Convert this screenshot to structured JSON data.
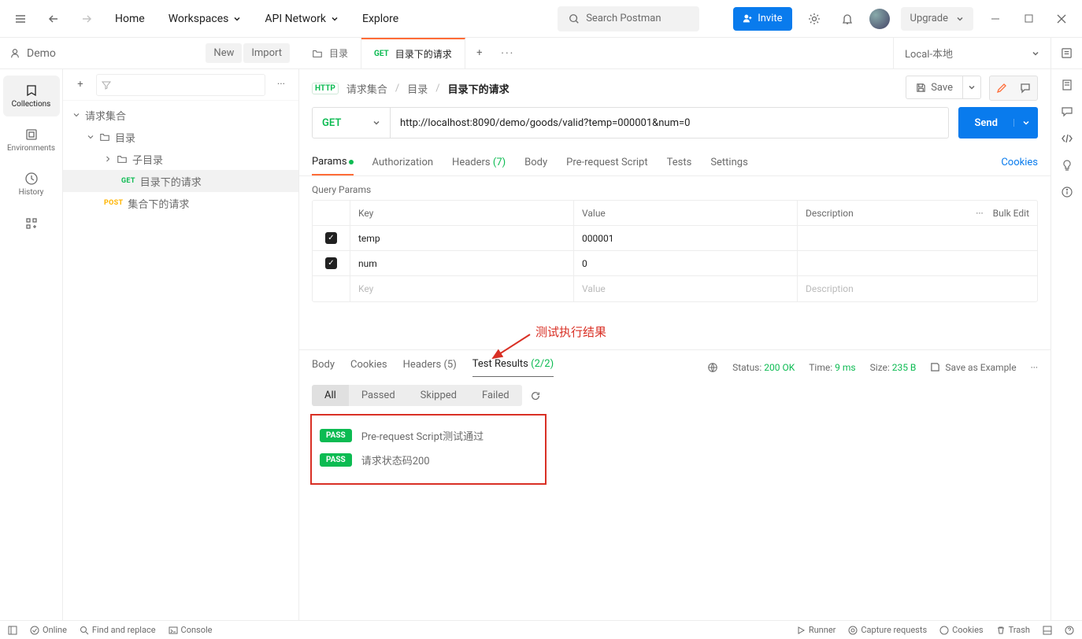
{
  "topbar": {
    "home": "Home",
    "workspaces": "Workspaces",
    "api_network": "API Network",
    "explore": "Explore",
    "search_placeholder": "Search Postman",
    "invite": "Invite",
    "upgrade": "Upgrade"
  },
  "workspace": {
    "name": "Demo",
    "new_btn": "New",
    "import_btn": "Import",
    "env_name": "Local-本地"
  },
  "tabs": {
    "tab1_label": "目录",
    "tab2_method": "GET",
    "tab2_label": "目录下的请求"
  },
  "leftnav": {
    "collections": "Collections",
    "environments": "Environments",
    "history": "History"
  },
  "tree": {
    "root": "请求集合",
    "folder1": "目录",
    "subfolder": "子目录",
    "req_sel_method": "GET",
    "req_sel_label": "目录下的请求",
    "req2_method": "POST",
    "req2_label": "集合下的请求"
  },
  "breadcrumb": {
    "http": "HTTP",
    "c1": "请求集合",
    "c2": "目录",
    "c3": "目录下的请求",
    "save": "Save"
  },
  "request": {
    "method": "GET",
    "url": "http://localhost:8090/demo/goods/valid?temp=000001&num=0",
    "send": "Send"
  },
  "req_tabs": {
    "params": "Params",
    "auth": "Authorization",
    "headers": "Headers",
    "headers_count": "(7)",
    "body": "Body",
    "pre": "Pre-request Script",
    "tests": "Tests",
    "settings": "Settings",
    "cookies": "Cookies"
  },
  "query_params": {
    "title": "Query Params",
    "h_key": "Key",
    "h_val": "Value",
    "h_desc": "Description",
    "bulk": "Bulk Edit",
    "rows": [
      {
        "key": "temp",
        "value": "000001"
      },
      {
        "key": "num",
        "value": "0"
      }
    ],
    "ph_key": "Key",
    "ph_val": "Value",
    "ph_desc": "Description"
  },
  "annotation_text": "测试执行结果",
  "response": {
    "tabs": {
      "body": "Body",
      "cookies": "Cookies",
      "headers": "Headers",
      "headers_cnt": "(5)",
      "tests": "Test Results",
      "tests_cnt": "(2/2)"
    },
    "status_label": "Status:",
    "status_val": "200 OK",
    "time_label": "Time:",
    "time_val": "9 ms",
    "size_label": "Size:",
    "size_val": "235 B",
    "save_example": "Save as Example",
    "filters": {
      "all": "All",
      "passed": "Passed",
      "skipped": "Skipped",
      "failed": "Failed"
    },
    "pass": "PASS",
    "results": [
      "Pre-request Script测试通过",
      "请求状态码200"
    ]
  },
  "footer": {
    "online": "Online",
    "find": "Find and replace",
    "console": "Console",
    "runner": "Runner",
    "capture": "Capture requests",
    "cookies": "Cookies",
    "trash": "Trash"
  }
}
